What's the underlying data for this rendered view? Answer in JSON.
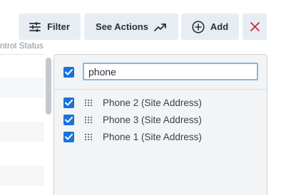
{
  "toolbar": {
    "filter_label": "Filter",
    "filter_icon": "sliders-icon",
    "actions_label": "See Actions",
    "actions_icon": "trending-up-icon",
    "add_label": "Add",
    "add_icon": "plus-circle-icon",
    "close_icon": "close-icon",
    "close_color": "#cc2b3b"
  },
  "table": {
    "column_header": "ntrol Status"
  },
  "column_chooser": {
    "select_all_checked": true,
    "search_value": "phone",
    "accent_color": "#1a73d9",
    "options": [
      {
        "label": "Phone 2 (Site Address)",
        "checked": true
      },
      {
        "label": "Phone 3 (Site Address)",
        "checked": true
      },
      {
        "label": "Phone 1 (Site Address)",
        "checked": true
      }
    ]
  }
}
